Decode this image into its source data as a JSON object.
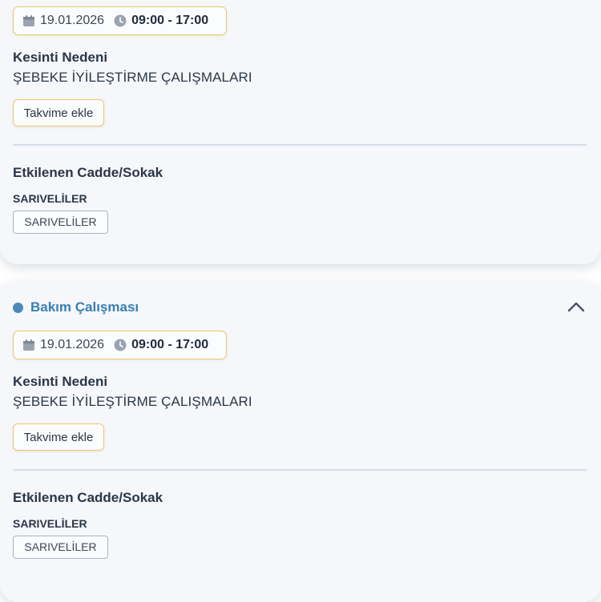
{
  "cards": [
    {
      "date": "19.01.2026",
      "time": "09:00 - 17:00",
      "reason_label": "Kesinti Nedeni",
      "reason_value": "ŞEBEKE İYİLEŞTİRME ÇALIŞMALARI",
      "calendar_button": "Takvime ekle",
      "affected_label": "Etkilenen Cadde/Sokak",
      "district": "SARIVELİLER",
      "street_tag": "SARIVELİLER"
    },
    {
      "status": "Bakım Çalışması",
      "date": "19.01.2026",
      "time": "09:00 - 17:00",
      "reason_label": "Kesinti Nedeni",
      "reason_value": "ŞEBEKE İYİLEŞTİRME ÇALIŞMALARI",
      "calendar_button": "Takvime ekle",
      "affected_label": "Etkilenen Cadde/Sokak",
      "district": "SARIVELİLER",
      "street_tag": "SARIVELİLER"
    }
  ],
  "icons": {
    "date": "calendar-icon",
    "time": "clock-icon",
    "collapse": "chevron-up-icon"
  },
  "colors": {
    "accent_border": "#f3c46a",
    "status_blue": "#3a7fb0",
    "card_bg": "#f5f7fb"
  }
}
